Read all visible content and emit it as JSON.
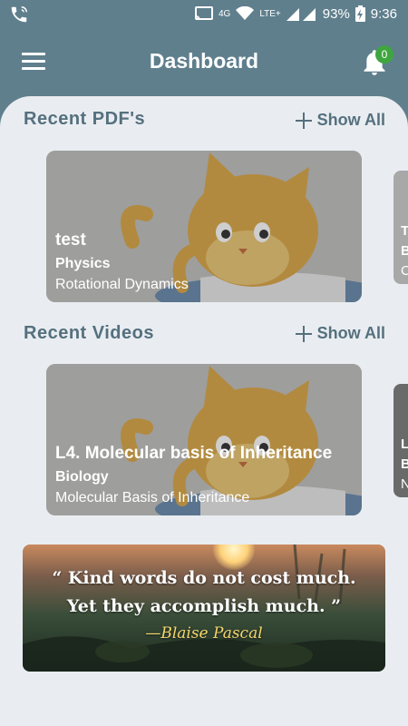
{
  "status_bar": {
    "network": "4G",
    "network_type": "LTE+",
    "battery": "93%",
    "time": "9:36",
    "icons": [
      "call-icon",
      "cast-icon",
      "wifi-icon",
      "signal-icon",
      "battery-charging-icon"
    ]
  },
  "app_bar": {
    "title": "Dashboard",
    "notification_count": "0"
  },
  "recent_pdfs": {
    "title": "Recent PDF's",
    "show_all": "Show All",
    "cards": [
      {
        "title": "test",
        "subject": "Physics",
        "topic": "Rotational Dynamics"
      }
    ],
    "peek": {
      "line1": "T",
      "line2": "B",
      "line3": "C"
    }
  },
  "recent_videos": {
    "title": "Recent Videos",
    "show_all": "Show All",
    "cards": [
      {
        "title": "L4. Molecular basis of Inheritance",
        "subject": "Biology",
        "topic": "Molecular Basis of Inheritance"
      }
    ],
    "peek": {
      "line1": "L",
      "line2": "B",
      "line3": "N"
    }
  },
  "quote": {
    "line1": "“ Kind words do not cost much.",
    "line2": "Yet they accomplish much. ”",
    "author": "—Blaise Pascal"
  },
  "colors": {
    "header": "#5f7f8d",
    "sheet": "#e9edf1",
    "section_text": "#55707e",
    "badge": "#3fa63f"
  }
}
